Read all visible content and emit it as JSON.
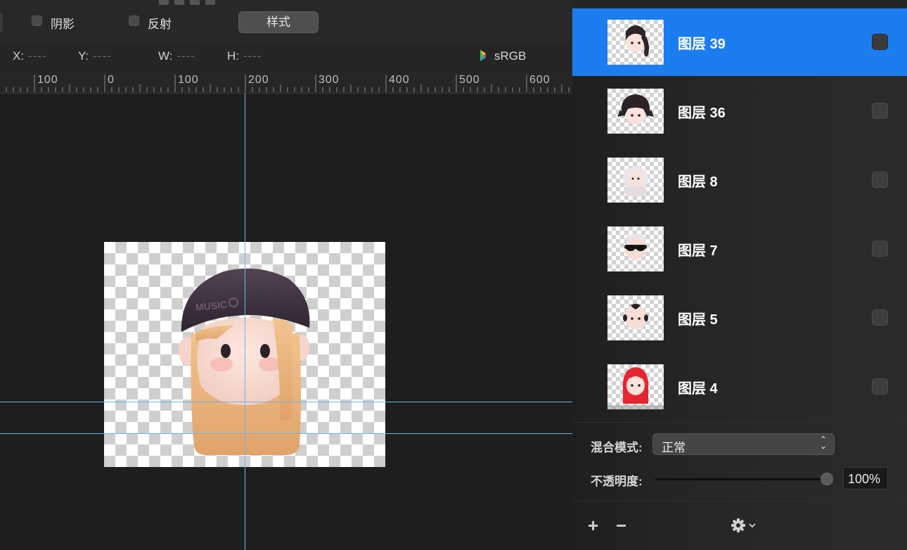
{
  "options_bar": {
    "shadow_label": "阴影",
    "reflection_label": "反射",
    "style_button": "样式"
  },
  "coordinates": {
    "x_label": "X:",
    "x_value": "----",
    "y_label": "Y:",
    "y_value": "----",
    "w_label": "W:",
    "w_value": "----",
    "h_label": "H:",
    "h_value": "----",
    "color_profile": "sRGB"
  },
  "ruler": {
    "labels": [
      "100",
      "0",
      "100",
      "200",
      "300",
      "400",
      "500",
      "600"
    ]
  },
  "canvas": {
    "cap_text": "MUSIC"
  },
  "layers_panel": {
    "layers": [
      {
        "name": "图层 39",
        "selected": true
      },
      {
        "name": "图层 36",
        "selected": false
      },
      {
        "name": "图层 8",
        "selected": false
      },
      {
        "name": "图层 7",
        "selected": false
      },
      {
        "name": "图层 5",
        "selected": false
      },
      {
        "name": "图层 4",
        "selected": false
      }
    ],
    "blend_mode_label": "混合模式:",
    "blend_mode_value": "正常",
    "opacity_label": "不透明度:",
    "opacity_value": "100%",
    "opacity_fraction": 1.0,
    "add_button": "+",
    "remove_button": "−"
  },
  "colors": {
    "selection": "#1c7df0",
    "guide": "#6fb6e6",
    "background": "#1e1e1e"
  }
}
